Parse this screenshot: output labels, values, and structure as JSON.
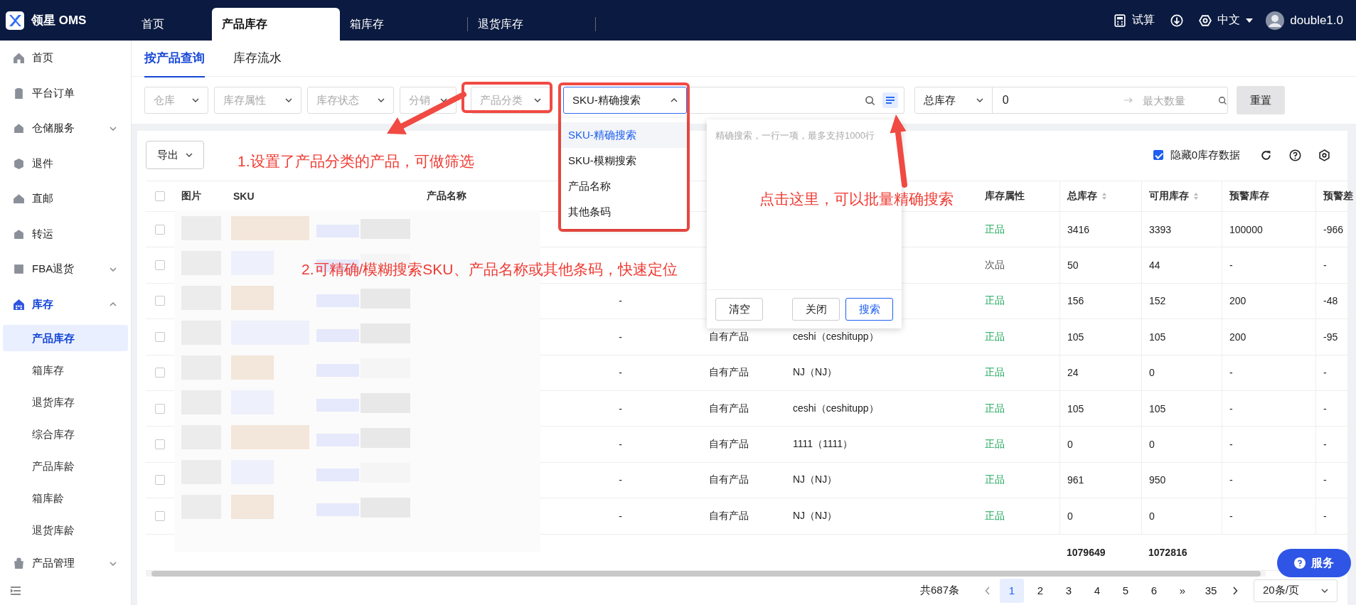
{
  "app": {
    "logo": "领星 OMS"
  },
  "top_tabs": [
    {
      "label": "首页",
      "selected": false
    },
    {
      "label": "产品库存",
      "selected": true
    },
    {
      "label": "箱库存",
      "selected": false
    },
    {
      "label": "退货库存",
      "selected": false
    }
  ],
  "header_actions": {
    "trial": "试算",
    "language": "中文",
    "user": "double1.0"
  },
  "sidebar": {
    "items": [
      {
        "label": "首页",
        "selected": false
      },
      {
        "label": "平台订单",
        "selected": false
      },
      {
        "label": "仓储服务",
        "selected": false,
        "expanded": false
      },
      {
        "label": "退件",
        "selected": false
      },
      {
        "label": "直邮",
        "selected": false
      },
      {
        "label": "转运",
        "selected": false
      },
      {
        "label": "FBA退货",
        "selected": false,
        "expanded": false
      },
      {
        "label": "库存",
        "selected": true,
        "expanded": true,
        "children": [
          {
            "label": "产品库存",
            "selected": true
          },
          {
            "label": "箱库存",
            "selected": false
          },
          {
            "label": "退货库存",
            "selected": false
          },
          {
            "label": "综合库存",
            "selected": false
          },
          {
            "label": "产品库龄",
            "selected": false
          },
          {
            "label": "箱库龄",
            "selected": false
          },
          {
            "label": "退货库龄",
            "selected": false
          }
        ]
      },
      {
        "label": "产品管理",
        "selected": false,
        "expanded": false
      }
    ]
  },
  "sub_tabs": [
    {
      "label": "按产品查询",
      "selected": true
    },
    {
      "label": "库存流水",
      "selected": false
    }
  ],
  "filters": {
    "selects": [
      {
        "placeholder": "仓库"
      },
      {
        "placeholder": "库存属性"
      },
      {
        "placeholder": "库存状态"
      },
      {
        "placeholder": "分销"
      },
      {
        "placeholder": "产品分类"
      }
    ],
    "search_type": {
      "value": "SKU-精确搜索",
      "open": true,
      "options": [
        {
          "label": "SKU-精确搜索",
          "selected": true
        },
        {
          "label": "SKU-模糊搜索",
          "selected": false
        },
        {
          "label": "产品名称",
          "selected": false
        },
        {
          "label": "其他条码",
          "selected": false
        }
      ]
    },
    "range": {
      "type": "总库存",
      "min": "0",
      "max_placeholder": "最大数量"
    },
    "reset": "重置"
  },
  "batch_popover": {
    "placeholder": "精确搜索，一行一项，最多支持1000行",
    "buttons": [
      {
        "label": "清空",
        "primary": false
      },
      {
        "label": "关闭",
        "primary": false
      },
      {
        "label": "搜索",
        "primary": true
      }
    ]
  },
  "toolbar": {
    "export": "导出",
    "hide_zero": {
      "label": "隐藏0库存数据",
      "checked": true
    }
  },
  "table": {
    "header_checked": false,
    "columns": [
      {
        "label": "图片",
        "sortable": false
      },
      {
        "label": "SKU",
        "sortable": false
      },
      {
        "label": "产品名称",
        "sortable": false
      },
      {
        "label": "库存属性",
        "sortable": false
      },
      {
        "label": "总库存",
        "sortable": true
      },
      {
        "label": "可用库存",
        "sortable": true
      },
      {
        "label": "预警库存",
        "sortable": false
      },
      {
        "label": "预警差",
        "sortable": false
      }
    ],
    "rows": [
      {
        "checked": false,
        "attr": "正品",
        "color": "#1ea75a",
        "total": "3416",
        "available": "3393",
        "warning": "100000",
        "warning_diff": "-966"
      },
      {
        "checked": false,
        "attr": "次品",
        "color": "#555555",
        "total": "50",
        "available": "44",
        "warning": "-",
        "warning_diff": "-"
      },
      {
        "checked": false,
        "col_5": "-",
        "attr": "正品",
        "color": "#1ea75a",
        "total": "156",
        "available": "152",
        "warning": "200",
        "warning_diff": "-48"
      },
      {
        "checked": false,
        "col_5": "-",
        "col_6": "自有产品",
        "col_7": "ceshi（ceshitupp）",
        "attr": "正品",
        "color": "#1ea75a",
        "total": "105",
        "available": "105",
        "warning": "200",
        "warning_diff": "-95"
      },
      {
        "checked": false,
        "col_5": "-",
        "col_6": "自有产品",
        "col_7": "NJ（NJ）",
        "attr": "正品",
        "color": "#1ea75a",
        "total": "24",
        "available": "0",
        "warning": "-",
        "warning_diff": "-"
      },
      {
        "checked": false,
        "col_5": "-",
        "col_6": "自有产品",
        "col_7": "ceshi（ceshitupp）",
        "attr": "正品",
        "color": "#1ea75a",
        "total": "105",
        "available": "105",
        "warning": "-",
        "warning_diff": "-"
      },
      {
        "checked": false,
        "col_5": "-",
        "col_6": "自有产品",
        "col_7": "1111（1111）",
        "attr": "正品",
        "color": "#1ea75a",
        "total": "0",
        "available": "0",
        "warning": "-",
        "warning_diff": "-"
      },
      {
        "checked": false,
        "col_5": "-",
        "col_6": "自有产品",
        "col_7": "NJ（NJ）",
        "attr": "正品",
        "color": "#1ea75a",
        "total": "961",
        "available": "950",
        "warning": "-",
        "warning_diff": "-"
      },
      {
        "checked": false,
        "col_5": "-",
        "col_6": "自有产品",
        "col_7": "NJ（NJ）",
        "attr": "正品",
        "color": "#1ea75a",
        "total": "0",
        "available": "0",
        "warning": "-",
        "warning_diff": "-"
      }
    ],
    "summary": {
      "total": "1079649",
      "available": "1072816"
    }
  },
  "pagination": {
    "total": "共687条",
    "pages": [
      {
        "label": "1",
        "selected": true
      },
      {
        "label": "2",
        "selected": false
      },
      {
        "label": "3",
        "selected": false
      },
      {
        "label": "4",
        "selected": false
      },
      {
        "label": "5",
        "selected": false
      },
      {
        "label": "6",
        "selected": false
      },
      {
        "label": "»",
        "selected": false
      },
      {
        "label": "35",
        "selected": false
      }
    ],
    "page_size": "20条/页"
  },
  "service": "服务",
  "annotations": [
    "1.设置了产品分类的产品，可做筛选",
    "2.可精确/模糊搜索SKU、产品名称或其他条码，快速定位",
    "点击这里，可以批量精确搜索"
  ]
}
